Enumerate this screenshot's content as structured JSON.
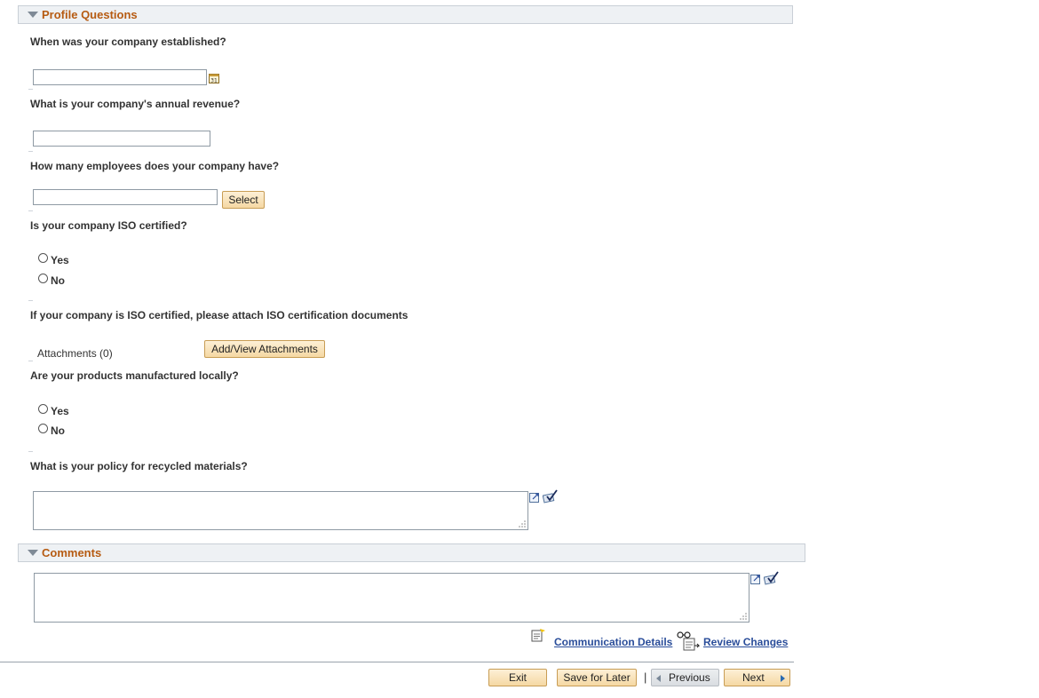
{
  "profile_section": {
    "title": "Profile Questions"
  },
  "questions": {
    "q1": {
      "text": "When was your company established?",
      "value": ""
    },
    "q2": {
      "text": "What is your company's annual revenue?",
      "value": ""
    },
    "q3": {
      "text": "How many employees does your company have?",
      "value": "",
      "button": "Select"
    },
    "q4": {
      "text": "Is your company ISO certified?",
      "options": [
        "Yes",
        "No"
      ]
    },
    "q5": {
      "text": "If your company is ISO certified, please attach ISO certification documents",
      "attachments_label": "Attachments (0)",
      "button": "Add/View Attachments"
    },
    "q6": {
      "text": "Are your products manufactured locally?",
      "options": [
        "Yes",
        "No"
      ]
    },
    "q7": {
      "text": "What is your policy for recycled materials?",
      "value": ""
    }
  },
  "comments_section": {
    "title": "Comments",
    "value": ""
  },
  "links": {
    "communication": "Communication Details",
    "review": "Review Changes"
  },
  "footer": {
    "exit": "Exit",
    "save": "Save for Later",
    "previous": "Previous",
    "next": "Next",
    "separator": "|"
  },
  "icons": {
    "calendar": "calendar-icon",
    "expand": "expand-textarea-icon",
    "spellcheck": "spell-check-icon",
    "communication": "communication-details-icon",
    "review": "review-changes-icon"
  }
}
